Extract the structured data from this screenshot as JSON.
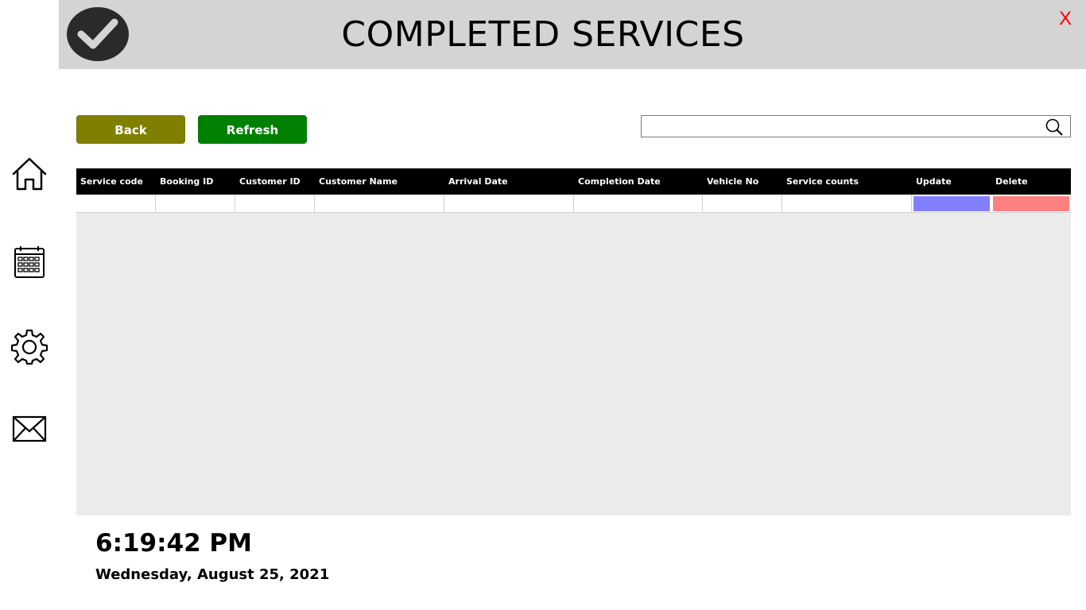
{
  "header": {
    "title": "COMPLETED SERVICES",
    "close_label": "X"
  },
  "sidebar": {
    "icons": [
      "home-icon",
      "calendar-icon",
      "gear-icon",
      "mail-icon"
    ]
  },
  "toolbar": {
    "back_label": "Back",
    "refresh_label": "Refresh"
  },
  "search": {
    "value": "",
    "placeholder": ""
  },
  "grid": {
    "columns": [
      "Service code",
      "Booking ID",
      "Customer ID",
      "Customer Name",
      "Arrival Date",
      "Completion Date",
      "Vehicle No",
      "Service counts",
      "Update",
      "Delete"
    ],
    "row": [
      "",
      "",
      "",
      "",
      "",
      "",
      "",
      ""
    ]
  },
  "colors": {
    "header_bg": "#d4d4d4",
    "back_button": "#808000",
    "refresh_button": "#008000",
    "update_cell": "#8080ff",
    "delete_cell": "#ff8080",
    "close": "#ff0000"
  },
  "footer": {
    "time": "6:19:42 PM",
    "date": "Wednesday, August 25, 2021"
  }
}
